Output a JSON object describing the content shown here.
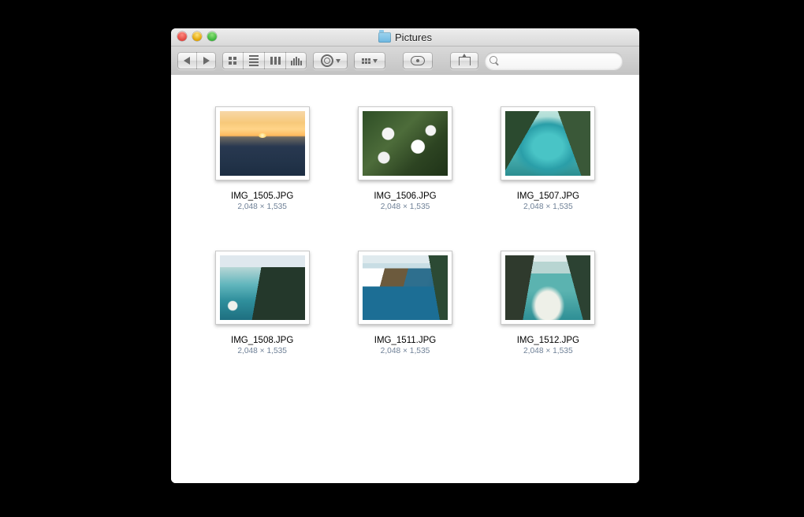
{
  "window": {
    "title": "Pictures"
  },
  "search": {
    "placeholder": ""
  },
  "items": [
    {
      "filename": "IMG_1505.JPG",
      "dimensions": "2,048 × 1,535",
      "thumb": "sunset"
    },
    {
      "filename": "IMG_1506.JPG",
      "dimensions": "2,048 × 1,535",
      "thumb": "daisies"
    },
    {
      "filename": "IMG_1507.JPG",
      "dimensions": "2,048 × 1,535",
      "thumb": "coast1"
    },
    {
      "filename": "IMG_1508.JPG",
      "dimensions": "2,048 × 1,535",
      "thumb": "coast2"
    },
    {
      "filename": "IMG_1511.JPG",
      "dimensions": "2,048 × 1,535",
      "thumb": "coast3"
    },
    {
      "filename": "IMG_1512.JPG",
      "dimensions": "2,048 × 1,535",
      "thumb": "coast4"
    }
  ]
}
